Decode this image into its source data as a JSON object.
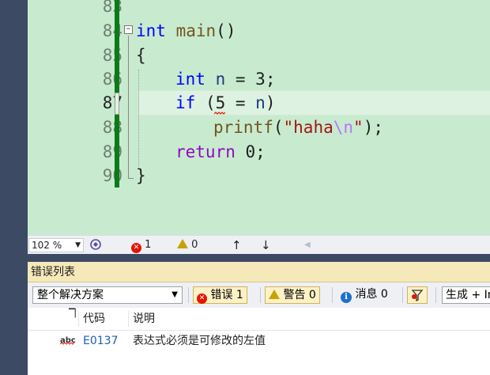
{
  "editor": {
    "lines": [
      {
        "num": "83"
      },
      {
        "num": "84"
      },
      {
        "num": "85"
      },
      {
        "num": "86"
      },
      {
        "num": "87"
      },
      {
        "num": "88"
      },
      {
        "num": "89"
      },
      {
        "num": "90"
      }
    ],
    "code": {
      "l84_kw": "int",
      "l84_fn": "main",
      "l84_rest": "()",
      "l85": "{",
      "l86_kw": "int",
      "l86_var": "n",
      "l86_rest": " = 3;",
      "l87_kw": "if",
      "l87_a": " (5 = ",
      "l87_var": "n",
      "l87_b": ")",
      "l88_fn": "printf",
      "l88_a": "(",
      "l88_str": "\"haha",
      "l88_esc": "\\n",
      "l88_str2": "\"",
      "l88_b": ");",
      "l89_kw": "return",
      "l89_rest": " 0;",
      "l90": "}"
    }
  },
  "status": {
    "zoom": "102 %",
    "errors": "1",
    "warnings": "0",
    "up_arrow": "↑",
    "down_arrow": "↓"
  },
  "error_list": {
    "title": "错误列表",
    "scope": "整个解决方案",
    "errors_btn": "错误 1",
    "warnings_btn": "警告 0",
    "messages_btn": "消息 0",
    "build_filter": "生成 + IntelliSense",
    "columns": {
      "code": "代码",
      "description": "说明"
    },
    "rows": [
      {
        "icon_text": "abc",
        "code": "E0137",
        "description": "表达式必须是可修改的左值"
      }
    ]
  },
  "colors": {
    "editor_bg": "#c8ebcf",
    "change_bar": "#0d7a1a",
    "title_bar": "#f5e8b9",
    "error": "#e51400",
    "link": "#1a5fb4"
  }
}
